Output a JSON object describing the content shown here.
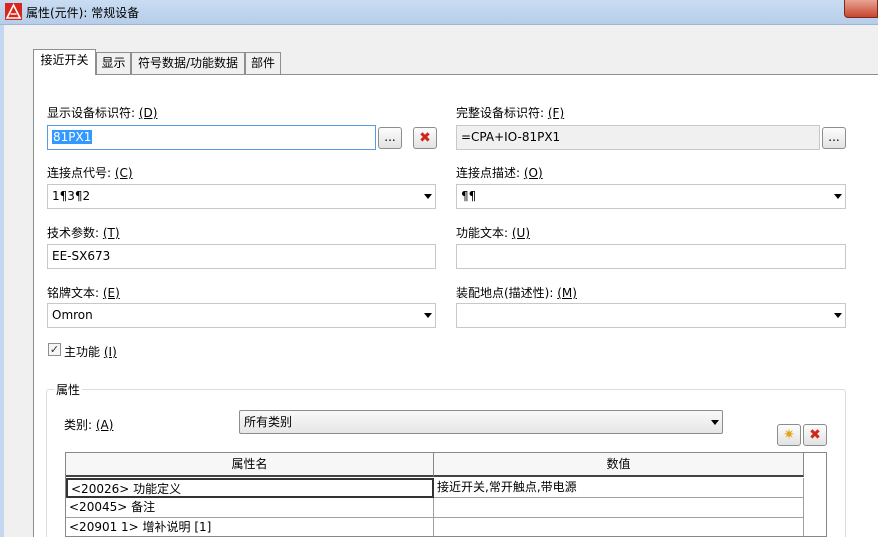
{
  "window": {
    "title": "属性(元件): 常规设备"
  },
  "tabs": [
    {
      "label": "接近开关",
      "active": true
    },
    {
      "label": "显示"
    },
    {
      "label": "符号数据/功能数据"
    },
    {
      "label": "部件"
    }
  ],
  "form": {
    "display_dt_label": "显示设备标识符:",
    "display_dt_key": "(D)",
    "display_dt_value": "81PX1",
    "full_dt_label": "完整设备标识符:",
    "full_dt_key": "(F)",
    "full_dt_value": "=CPA+IO-81PX1",
    "conn_code_label": "连接点代号:",
    "conn_code_key": "(C)",
    "conn_code_value": "1¶3¶2",
    "conn_desc_label": "连接点描述:",
    "conn_desc_key": "(O)",
    "conn_desc_value": "¶¶",
    "tech_label": "技术参数:",
    "tech_key": "(T)",
    "tech_value": "EE-SX673",
    "func_text_label": "功能文本:",
    "func_text_key": "(U)",
    "func_text_value": "",
    "nameplate_label": "铭牌文本:",
    "nameplate_key": "(E)",
    "nameplate_value": "Omron",
    "mount_label": "装配地点(描述性):",
    "mount_key": "(M)",
    "mount_value": "",
    "main_func_label": "主功能",
    "main_func_key": "(I)",
    "main_func_checked": true,
    "browse_label": "...",
    "clear_icon": "red-x-icon"
  },
  "properties": {
    "group_title": "属性",
    "category_label": "类别:",
    "category_key": "(A)",
    "category_value": "所有类别",
    "new_icon": "new-star-icon",
    "delete_icon": "red-x-icon",
    "columns": [
      "属性名",
      "数值"
    ],
    "rows": [
      {
        "name": "<20026> 功能定义",
        "value": "接近开关,常开触点,带电源"
      },
      {
        "name": "<20045> 备注",
        "value": ""
      },
      {
        "name": "<20901 1> 增补说明 [1]",
        "value": ""
      }
    ]
  },
  "colors": {
    "title_bar": "#b6cde9",
    "selection": "#3399ff",
    "close_button": "#c7462f",
    "delete_red": "#d3261a"
  }
}
